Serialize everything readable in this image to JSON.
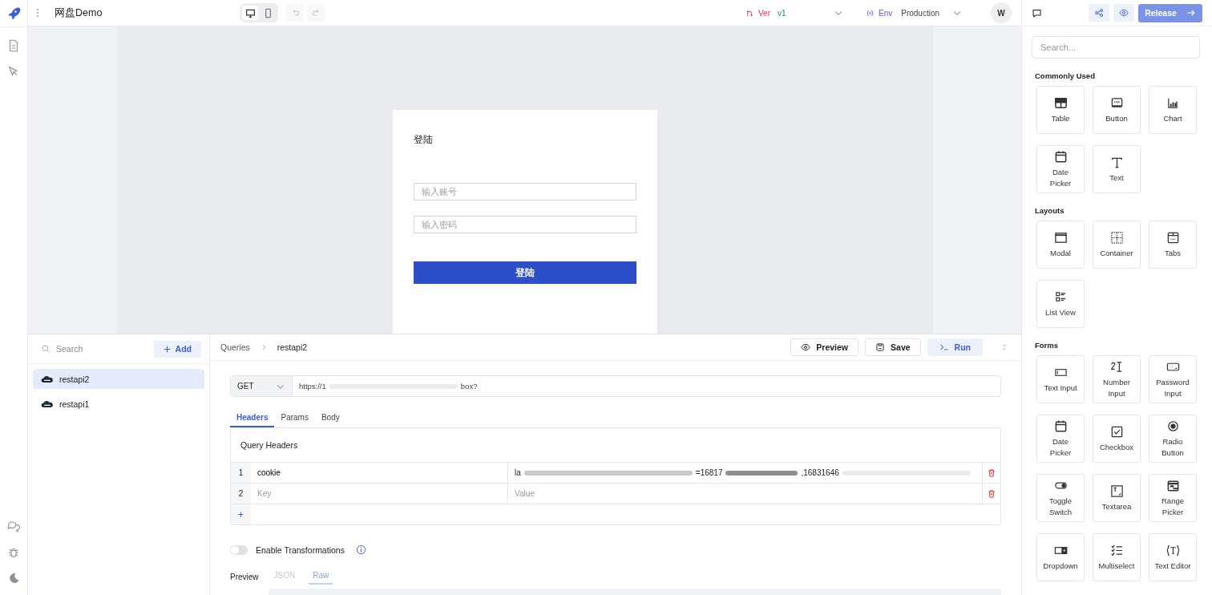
{
  "app": {
    "title": "网盘Demo"
  },
  "topbar": {
    "devices": [
      {
        "kind": "desktop",
        "selected": true
      },
      {
        "kind": "mobile",
        "selected": false
      }
    ],
    "version": {
      "label": "Ver",
      "value": "v1"
    },
    "env": {
      "label": "Env",
      "value": "Production"
    },
    "avatar": "W",
    "release": "Release"
  },
  "canvas": {
    "title": "登陆",
    "fields": [
      {
        "placeholder": "输入账号"
      },
      {
        "placeholder": "输入密码"
      }
    ],
    "button": "登陆"
  },
  "queries": {
    "search": {
      "placeholder": "Search"
    },
    "add": "Add",
    "items": [
      {
        "name": "restapi2",
        "selected": true
      },
      {
        "name": "restapi1",
        "selected": false
      }
    ]
  },
  "editor": {
    "breadcrumb": [
      "Queries",
      "restapi2"
    ],
    "actions": [
      {
        "kind": "preview",
        "label": "Preview"
      },
      {
        "kind": "save",
        "label": "Save"
      },
      {
        "kind": "run",
        "label": "Run"
      }
    ],
    "method": "GET",
    "url": {
      "start": "https://1",
      "end": "box?"
    },
    "tabs": [
      {
        "label": "Headers",
        "selected": true
      },
      {
        "label": "Params",
        "selected": false
      },
      {
        "label": "Body",
        "selected": false
      }
    ],
    "headers": {
      "title": "Query Headers",
      "rows": [
        {
          "index": "1",
          "key": "cookie",
          "value": "la",
          "value_tail": "=16817",
          "value_end": ",16831646"
        },
        {
          "index": "2",
          "key_placeholder": "Key",
          "value_placeholder": "Value"
        }
      ],
      "add": "+"
    },
    "transform": {
      "label": "Enable Transformations",
      "on": false
    },
    "preview": {
      "label": "Preview",
      "tabs": [
        {
          "label": "JSON",
          "selected": false
        },
        {
          "label": "Raw",
          "selected": true
        }
      ]
    }
  },
  "palette": {
    "search": {
      "placeholder": "Search..."
    },
    "sections": [
      {
        "title": "Commonly Used",
        "items": [
          {
            "kind": "table",
            "label": "Table"
          },
          {
            "kind": "button",
            "label": "Button"
          },
          {
            "kind": "chart",
            "label": "Chart"
          },
          {
            "kind": "date",
            "label": "Date Picker"
          },
          {
            "kind": "text",
            "label": "Text"
          }
        ]
      },
      {
        "title": "Layouts",
        "items": [
          {
            "kind": "modal",
            "label": "Modal"
          },
          {
            "kind": "container",
            "label": "Container"
          },
          {
            "kind": "tabs",
            "label": "Tabs"
          },
          {
            "kind": "list",
            "label": "List View"
          }
        ]
      },
      {
        "title": "Forms",
        "items": [
          {
            "kind": "textinput",
            "label": "Text Input"
          },
          {
            "kind": "number",
            "label": "Number Input"
          },
          {
            "kind": "password",
            "label": "Password Input"
          },
          {
            "kind": "date",
            "label": "Date Picker"
          },
          {
            "kind": "checkbox",
            "label": "Checkbox"
          },
          {
            "kind": "radio",
            "label": "Radio Button"
          },
          {
            "kind": "toggle",
            "label": "Toggle Switch"
          },
          {
            "kind": "textarea",
            "label": "Textarea"
          },
          {
            "kind": "range",
            "label": "Range Picker"
          },
          {
            "kind": "dropdown",
            "label": "Dropdown"
          },
          {
            "kind": "multiselect",
            "label": "Multiselect"
          },
          {
            "kind": "editor",
            "label": "Text Editor"
          }
        ]
      }
    ]
  }
}
